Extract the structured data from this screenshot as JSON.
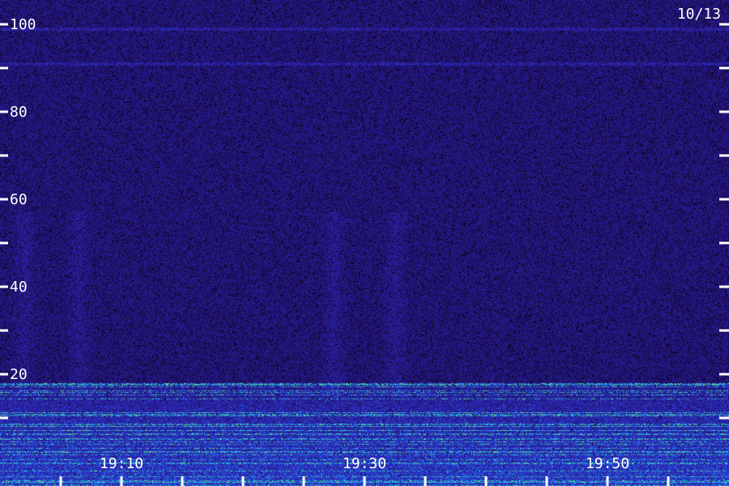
{
  "chart_data": {
    "type": "heatmap",
    "title": "",
    "xlabel": "",
    "ylabel": "",
    "date": "10/13",
    "y_tick_labels": [
      "20",
      "40",
      "60",
      "80",
      "100"
    ],
    "y_tick_values": [
      20,
      40,
      60,
      80,
      100
    ],
    "y_minor_tick_values": [
      10,
      30,
      50,
      70,
      90
    ],
    "ylim": [
      0,
      100
    ],
    "x_tick_labels": [
      "19:10",
      "19:30",
      "19:50"
    ],
    "x_tick_values_minutes": [
      10,
      30,
      50
    ],
    "x_minor_tick_values_minutes": [
      5,
      15,
      20,
      25,
      35,
      40,
      45,
      55
    ],
    "xlim_minutes": [
      0,
      60
    ],
    "grid": false,
    "colormap": [
      "#000000",
      "#1c0d5a",
      "#2a1fa0",
      "#2c3ad8",
      "#1f7de8",
      "#1ec8d8",
      "#8ef060"
    ],
    "background_color": "#1c0d5a",
    "features": {
      "horizontal_lines_y": [
        99,
        91
      ],
      "low_frequency_band_max": 18,
      "vertical_bursts_minutes": [
        2,
        6.5,
        27.5,
        32.5
      ]
    }
  }
}
